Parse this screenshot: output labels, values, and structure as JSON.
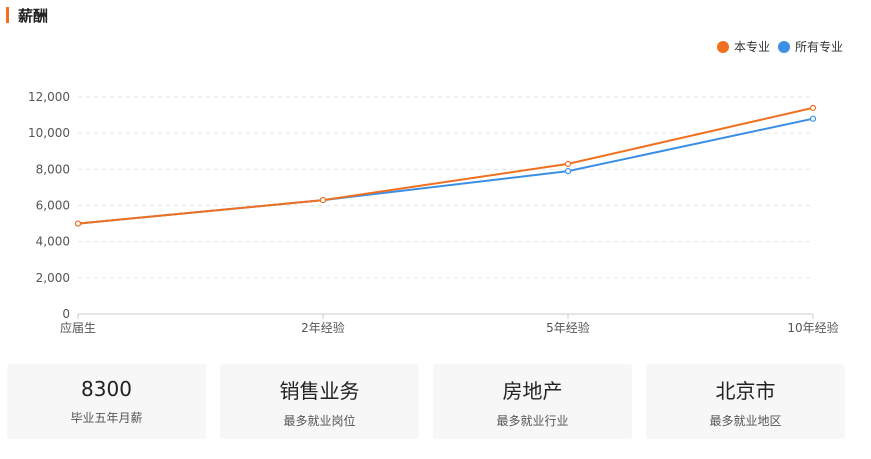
{
  "section": {
    "title": "薪酬"
  },
  "colors": {
    "accent": "#f07020",
    "major": "#f07020",
    "all": "#3b8fe4"
  },
  "chart_data": {
    "type": "line",
    "title": "",
    "xlabel": "",
    "ylabel": "",
    "categories": [
      "应届生",
      "2年经验",
      "5年经验",
      "10年经验"
    ],
    "series": [
      {
        "name": "本专业",
        "values": [
          5000,
          6300,
          8300,
          11400
        ]
      },
      {
        "name": "所有专业",
        "values": [
          5000,
          6300,
          7900,
          10800
        ]
      }
    ],
    "ylim": [
      0,
      12000
    ],
    "yticks": [
      "0",
      "2,000",
      "4,000",
      "6,000",
      "8,000",
      "10,000",
      "12,000"
    ],
    "grid": true,
    "legend_position": "top-right"
  },
  "cards": [
    {
      "value": "8300",
      "label": "毕业五年月薪"
    },
    {
      "value": "销售业务",
      "label": "最多就业岗位"
    },
    {
      "value": "房地产",
      "label": "最多就业行业"
    },
    {
      "value": "北京市",
      "label": "最多就业地区"
    }
  ]
}
